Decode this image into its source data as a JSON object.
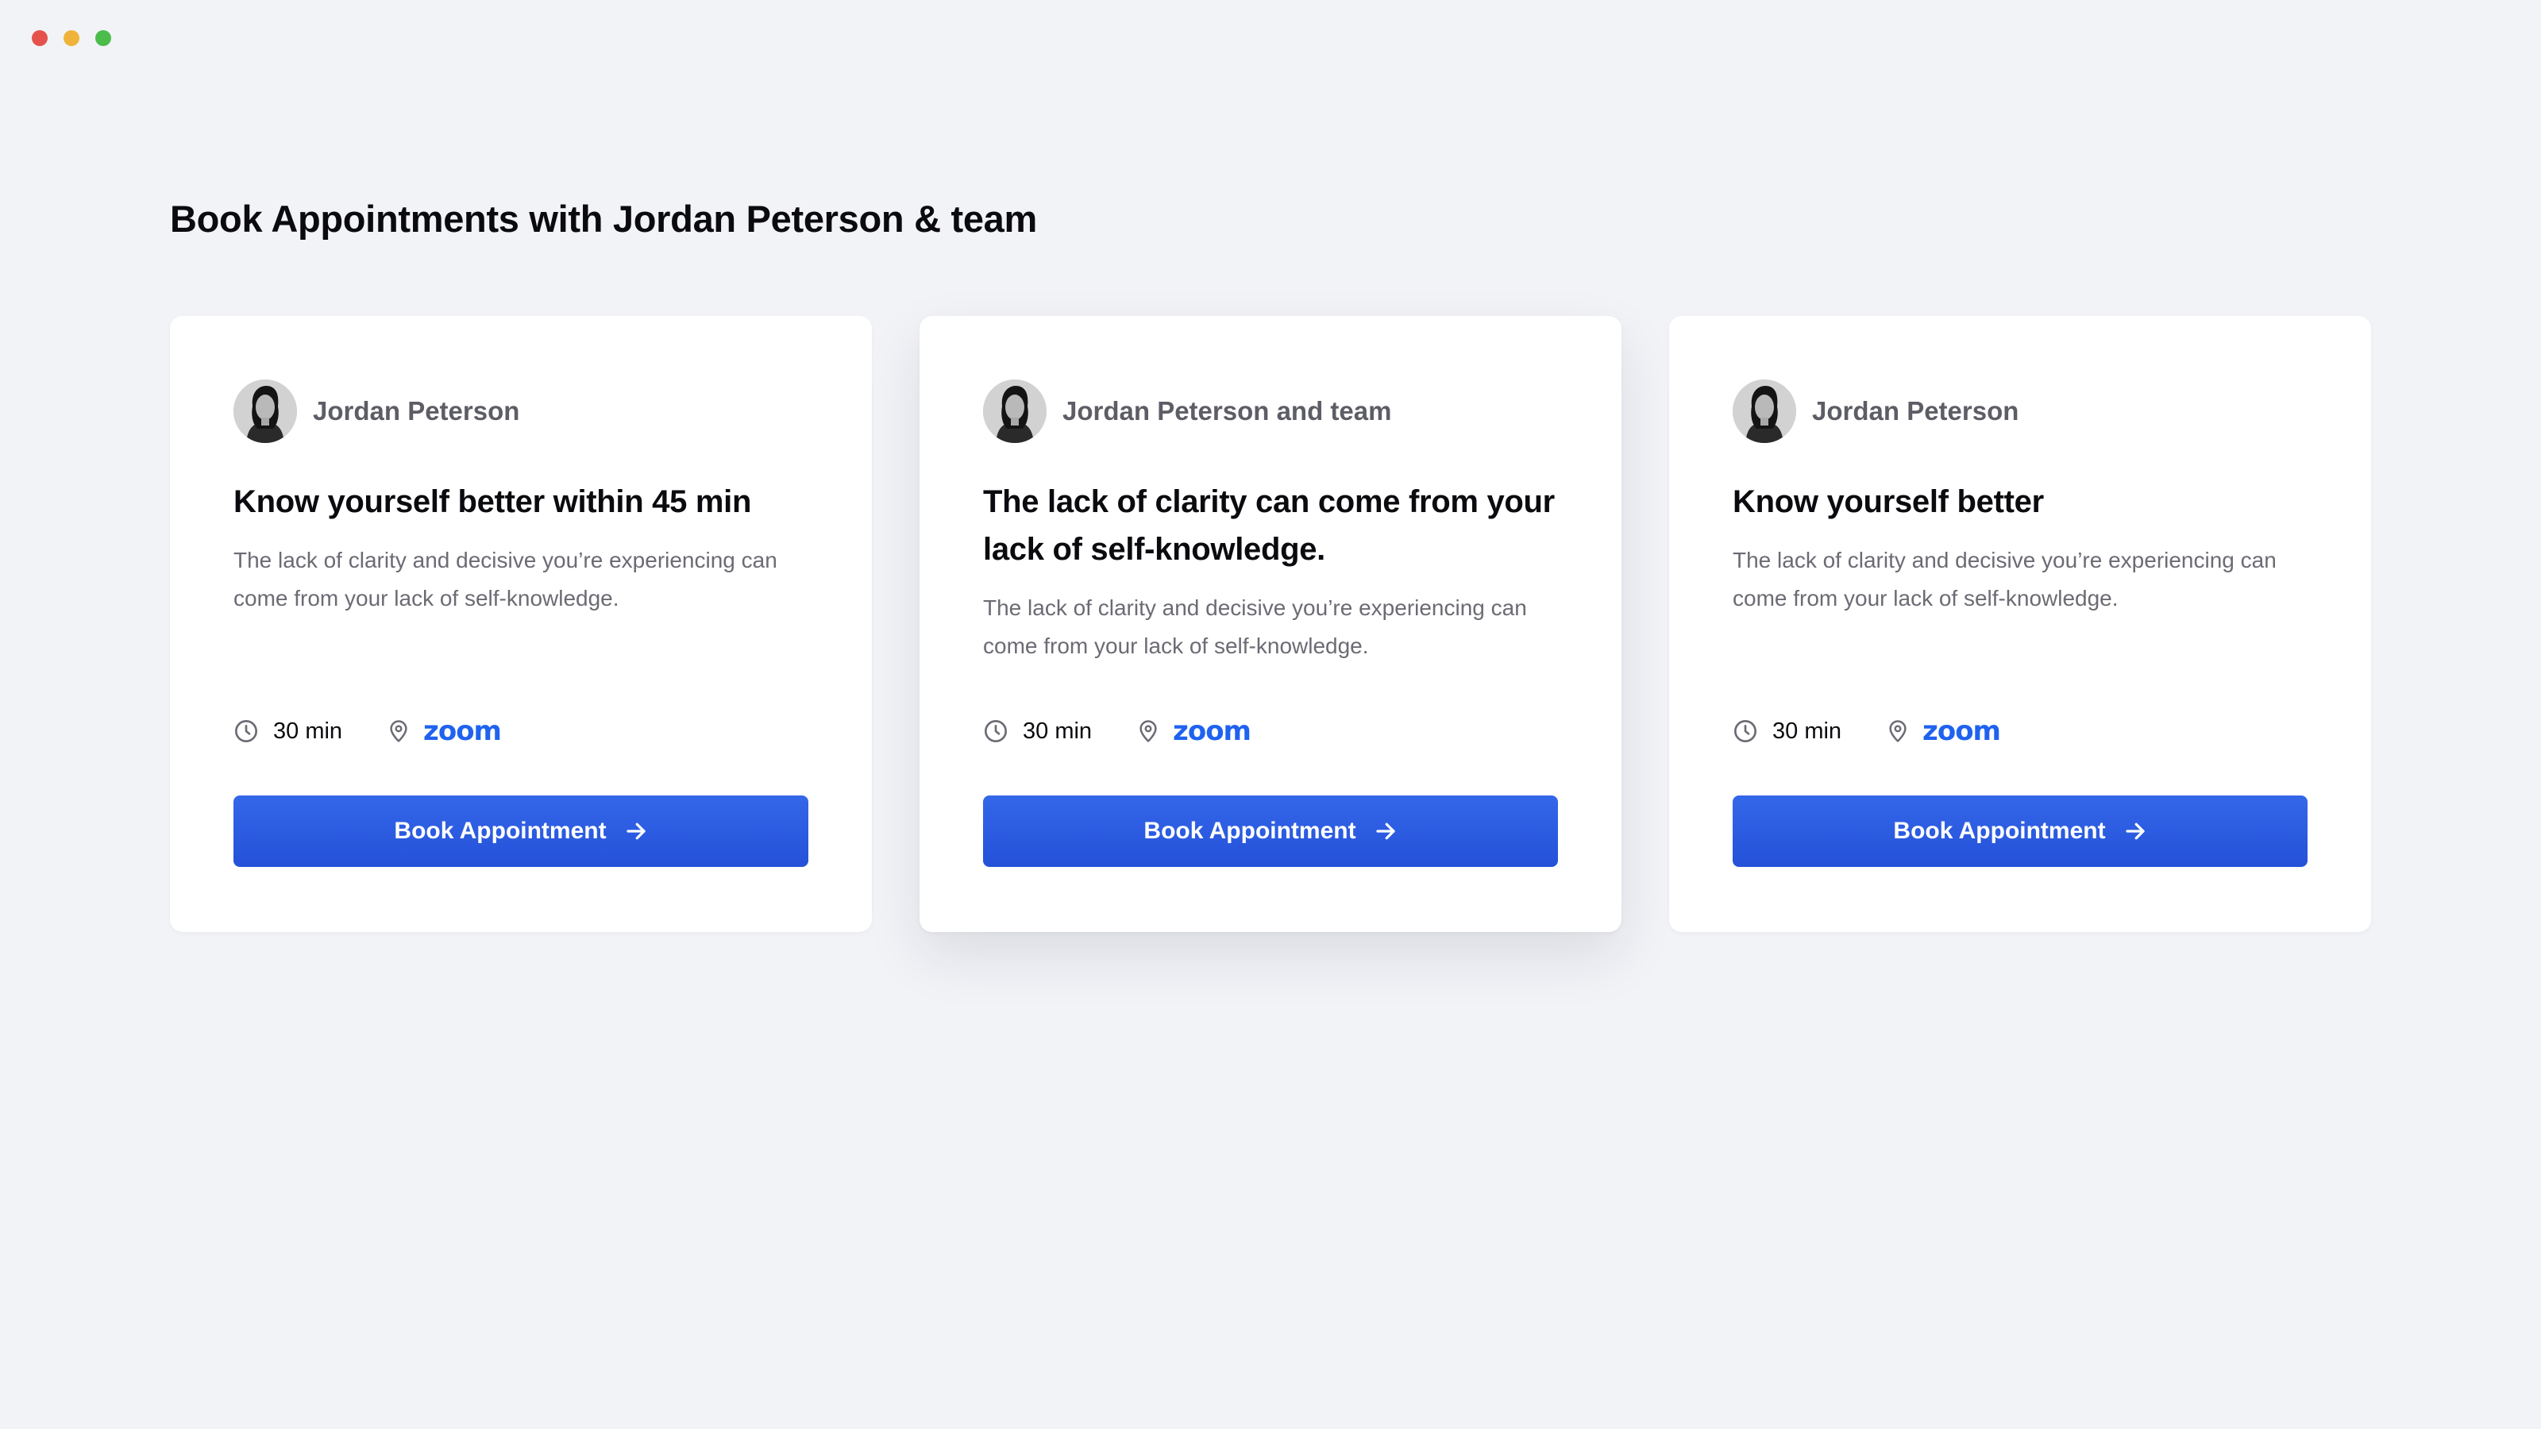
{
  "window": {
    "controls": [
      {
        "name": "close",
        "color": "#e5524c"
      },
      {
        "name": "minimize",
        "color": "#f0b33a"
      },
      {
        "name": "maximize",
        "color": "#4cbd4a"
      }
    ]
  },
  "page": {
    "title": "Book Appointments with Jordan Peterson & team"
  },
  "colors": {
    "background": "#f2f3f7",
    "card": "#ffffff",
    "accent": "#2d5ce3",
    "zoom": "#1f62f0",
    "muted_text": "#6b6b74"
  },
  "cards": [
    {
      "host_name": "Jordan Peterson",
      "title": "Know yourself better within 45 min",
      "description": "The lack of clarity and decisive you’re experiencing can come from your lack of self-knowledge.",
      "duration": "30 min",
      "duration_icon": "clock-icon",
      "location_icon": "map-pin-icon",
      "location": "zoom",
      "button_label": "Book Appointment",
      "featured": false
    },
    {
      "host_name": "Jordan Peterson and team",
      "title": "The lack of clarity can come from your lack of self-knowledge.",
      "description": "The lack of clarity and decisive you’re experiencing can come from your lack of self-knowledge.",
      "duration": "30 min",
      "duration_icon": "clock-icon",
      "location_icon": "map-pin-icon",
      "location": "zoom",
      "button_label": "Book Appointment",
      "featured": true
    },
    {
      "host_name": "Jordan Peterson",
      "title": "Know yourself better",
      "description": "The lack of clarity and decisive you’re experiencing can come from your lack of self-knowledge.",
      "duration": "30 min",
      "duration_icon": "clock-icon",
      "location_icon": "map-pin-icon",
      "location": "zoom",
      "button_label": "Book Appointment",
      "featured": false
    }
  ]
}
